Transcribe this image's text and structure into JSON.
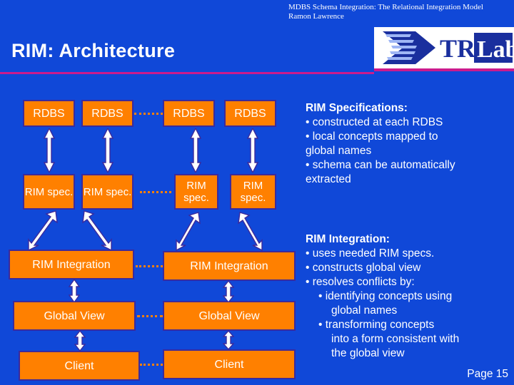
{
  "header": {
    "line1": "MDBS Schema Integration: The Relational Integration Model",
    "line2": "Ramon Lawrence",
    "logo_alt": "trlabs-logo",
    "logo_text_tr": "TR",
    "logo_text_labs": "Labs"
  },
  "title": "RIM: Architecture",
  "diagram": {
    "rdbs": [
      "RDBS",
      "RDBS",
      "RDBS",
      "RDBS"
    ],
    "rimspec": [
      "RIM spec.",
      "RIM spec.",
      "RIM spec.",
      "RIM spec."
    ],
    "integration": [
      "RIM Integration",
      "RIM Integration"
    ],
    "globalview": [
      "Global View",
      "Global View"
    ],
    "client": [
      "Client",
      "Client"
    ]
  },
  "specs_panel": {
    "heading": "RIM Specifications:",
    "items": [
      "• constructed at each RDBS",
      "• local concepts mapped to",
      "global names",
      "• schema can be automatically",
      "extracted"
    ]
  },
  "integration_panel": {
    "heading": "RIM Integration:",
    "items": [
      "• uses needed RIM specs.",
      "• constructs global view",
      "• resolves conflicts by:",
      "• identifying concepts using",
      "global names",
      "• transforming concepts",
      "into a form consistent with",
      "the global view"
    ]
  },
  "page_number": "Page 15",
  "colors": {
    "background": "#1048d8",
    "box_fill": "#ff8000",
    "box_border": "#3b2a9c",
    "accent_rule": "#cc1b8d",
    "text": "#ffffff"
  }
}
